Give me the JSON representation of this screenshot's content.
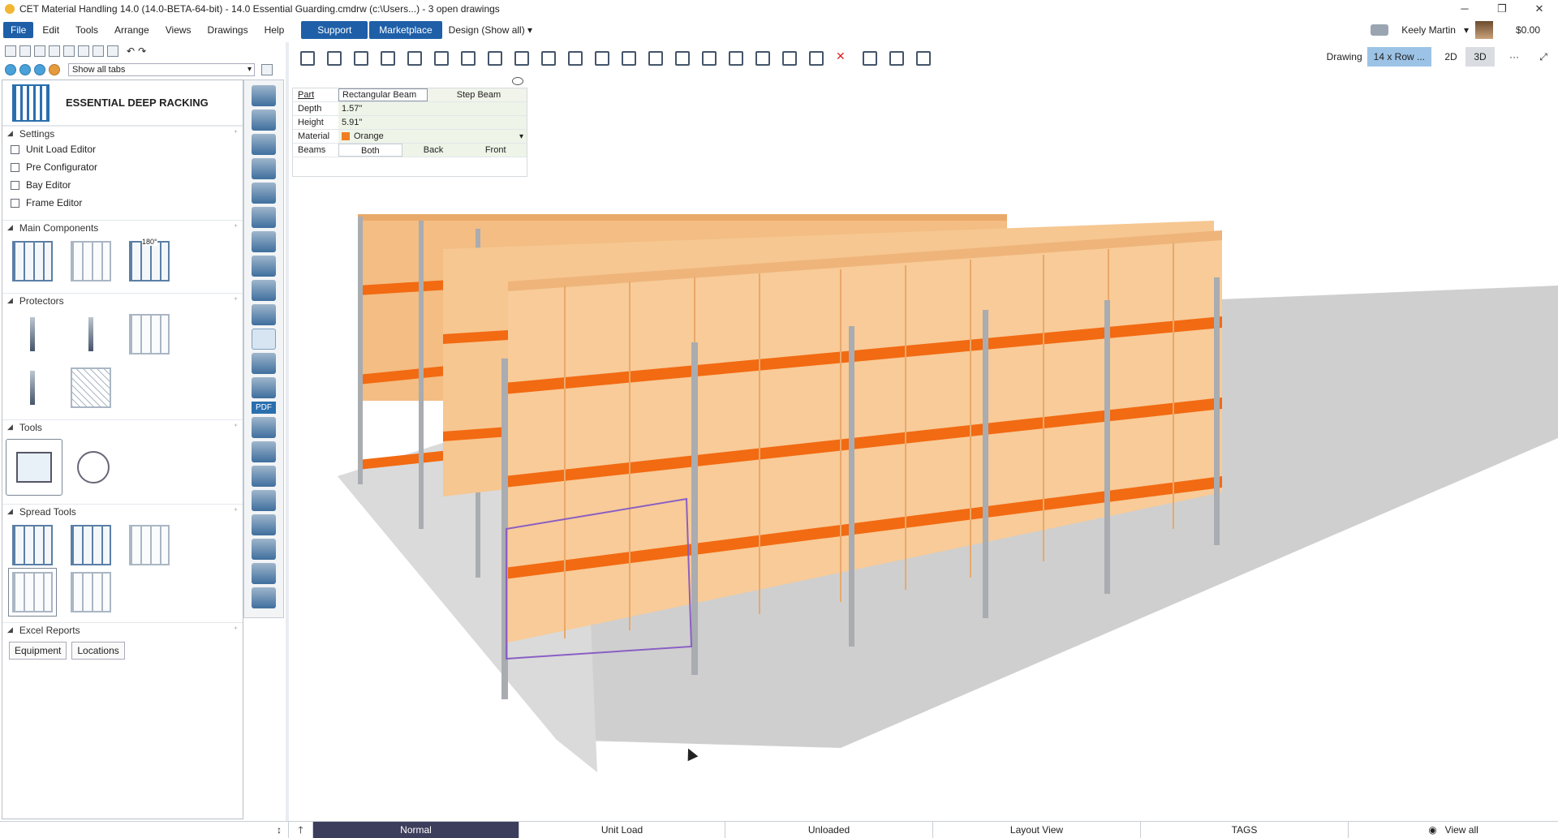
{
  "window": {
    "title": "CET Material Handling 14.0 (14.0-BETA-64-bit) - 14.0 Essential Guarding.cmdrw (c:\\Users...) - 3  open drawings",
    "controls": [
      "─",
      "❐",
      "✕"
    ]
  },
  "menu": {
    "items": [
      "File",
      "Edit",
      "Tools",
      "Arrange",
      "Views",
      "Drawings",
      "Help"
    ],
    "support": "Support",
    "marketplace": "Marketplace",
    "design": "Design (Show all)",
    "user": "Keely Martin",
    "balance": "$0.00"
  },
  "left_panel": {
    "tab_filter": "Show all tabs",
    "catalog_title": "ESSENTIAL DEEP RACKING",
    "sections": {
      "settings": "Settings",
      "main_components": "Main Components",
      "protectors": "Protectors",
      "tools": "Tools",
      "spread_tools": "Spread Tools",
      "excel_reports": "Excel Reports"
    },
    "settings_items": [
      "Unit Load Editor",
      "Pre Configurator",
      "Bay Editor",
      "Frame Editor"
    ],
    "excel_buttons": [
      "Equipment",
      "Locations"
    ],
    "palette_pdf": "PDF",
    "main_rotation_label": "180°"
  },
  "view_toolbar": {
    "drawing_label": "Drawing",
    "drawing_value": "14 x Row ...",
    "mode_2d": "2D",
    "mode_3d": "3D",
    "more": "···",
    "collapse": "⤢"
  },
  "properties": {
    "part_label": "Part",
    "part_options": [
      "Rectangular Beam",
      "Step Beam"
    ],
    "selected_part": "Rectangular Beam",
    "depth_label": "Depth",
    "depth_value": "1.57\"",
    "height_label": "Height",
    "height_value": "5.91\"",
    "material_label": "Material",
    "material_value": "Orange",
    "material_color": "#f07f22",
    "beams_label": "Beams",
    "beams_options": [
      "Both",
      "Back",
      "Front"
    ],
    "beams_selected": "Both"
  },
  "status_bar": {
    "segments": [
      "Normal",
      "Unit Load",
      "Unloaded",
      "Layout View",
      "TAGS",
      "View all"
    ]
  },
  "colors": {
    "accent": "#1e5fa8",
    "beam": "#f26a12",
    "box": "#f5c38a",
    "floor": "#c9c9c9",
    "upright": "#a9acb0"
  }
}
